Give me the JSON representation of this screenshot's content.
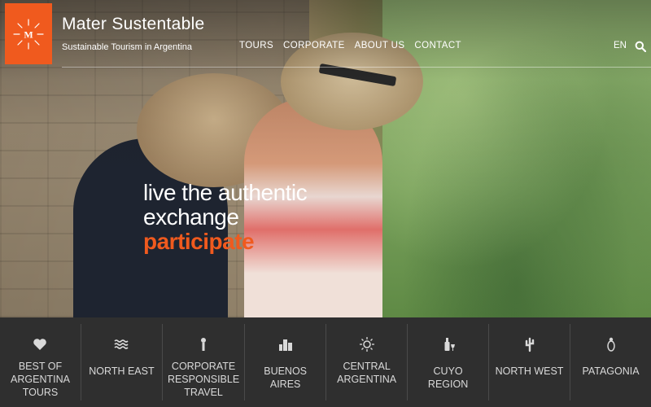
{
  "header": {
    "logo_letter": "M",
    "brand_title": "Mater Sustentable",
    "brand_subtitle": "Sustainable Tourism in Argentina",
    "nav": [
      "TOURS",
      "CORPORATE",
      "ABOUT US",
      "CONTACT"
    ],
    "lang": "EN",
    "accent_color": "#f05a1e"
  },
  "hero": {
    "line1": "live the authentic",
    "line2": "exchange",
    "line3": "participate"
  },
  "tiles": [
    {
      "icon": "heart-icon",
      "label": "BEST OF ARGENTINA TOURS"
    },
    {
      "icon": "waves-icon",
      "label": "NORTH EAST"
    },
    {
      "icon": "award-icon",
      "label": "CORPORATE RESPONSIBLE TRAVEL"
    },
    {
      "icon": "city-icon",
      "label": "BUENOS AIRES"
    },
    {
      "icon": "sun-icon",
      "label": "CENTRAL ARGENTINA"
    },
    {
      "icon": "wine-icon",
      "label": "CUYO REGION"
    },
    {
      "icon": "cactus-icon",
      "label": "NORTH WEST"
    },
    {
      "icon": "penguin-icon",
      "label": "PATAGONIA"
    }
  ]
}
